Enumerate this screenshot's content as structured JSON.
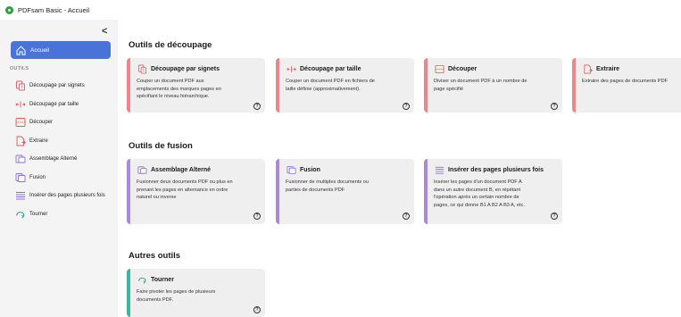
{
  "window": {
    "title": "PDFsam Basic - Accueil"
  },
  "sidebar": {
    "collapse_glyph": "<",
    "home_label": "Accueil",
    "section_label": "OUTILS",
    "items": [
      {
        "label": "Découpage par signets",
        "icon": "bookmark-split-icon"
      },
      {
        "label": "Découpage par taille",
        "icon": "size-split-icon"
      },
      {
        "label": "Découper",
        "icon": "split-icon"
      },
      {
        "label": "Extraire",
        "icon": "extract-icon"
      },
      {
        "label": "Assemblage Alterné",
        "icon": "alternate-mix-icon"
      },
      {
        "label": "Fusion",
        "icon": "merge-icon"
      },
      {
        "label": "Insérer des pages plusieurs fois",
        "icon": "insert-icon"
      },
      {
        "label": "Tourner",
        "icon": "rotate-icon"
      }
    ]
  },
  "main": {
    "sections": [
      {
        "title": "Outils de découpage"
      },
      {
        "title": "Outils de fusion"
      },
      {
        "title": "Autres outils"
      }
    ],
    "cards": [
      {
        "name": "Découpage par signets",
        "desc_lines": [
          "Couper un document PDF aux",
          "emplacements des marques pages en",
          "spécifiant le niveau hiérarchique."
        ],
        "help": "?"
      },
      {
        "name": "Découpage par taille",
        "desc_lines": [
          "Couper un document PDF en fichiers de",
          "taille définie (approximativement)."
        ],
        "help": "?"
      },
      {
        "name": "Découper",
        "desc_lines": [
          "Diviser un document PDF à un nombre de",
          "page spécifié"
        ],
        "help": "?"
      },
      {
        "name": "Extraire",
        "desc_lines": [
          "Extraire des pages de documents PDF"
        ],
        "help": "?"
      },
      {
        "name": "Assemblage Alterné",
        "desc_lines": [
          "Fusionner deux documents PDF ou plus en",
          "prenant les pages en alternance en ordre",
          "naturel ou inverse"
        ],
        "help": "?"
      },
      {
        "name": "Fusion",
        "desc_lines": [
          "Fusionner de multiples documents ou",
          "parties de documents PDF"
        ],
        "help": "?"
      },
      {
        "name": "Insérer des pages plusieurs fois",
        "desc_lines": [
          "Insérer les pages d'un document PDF A",
          "dans un autre document B, en répétant",
          "l'opération après un certain nombre de",
          "pages, ce qui donne B1 A B2 A B3 A, etc."
        ],
        "help": "?"
      },
      {
        "name": "Tourner",
        "desc_lines": [
          "Faire pivoter les pages de plusieurs",
          "documents PDF."
        ],
        "help": "?"
      }
    ]
  },
  "colors": {
    "accent_blue": "#4a73d9",
    "split_red": "#e8888a",
    "merge_purple": "#a78bd8",
    "other_teal": "#3fb39e",
    "icon_red": "#e0595c",
    "icon_purple": "#8b6fd0",
    "icon_teal": "#2fa28d"
  }
}
